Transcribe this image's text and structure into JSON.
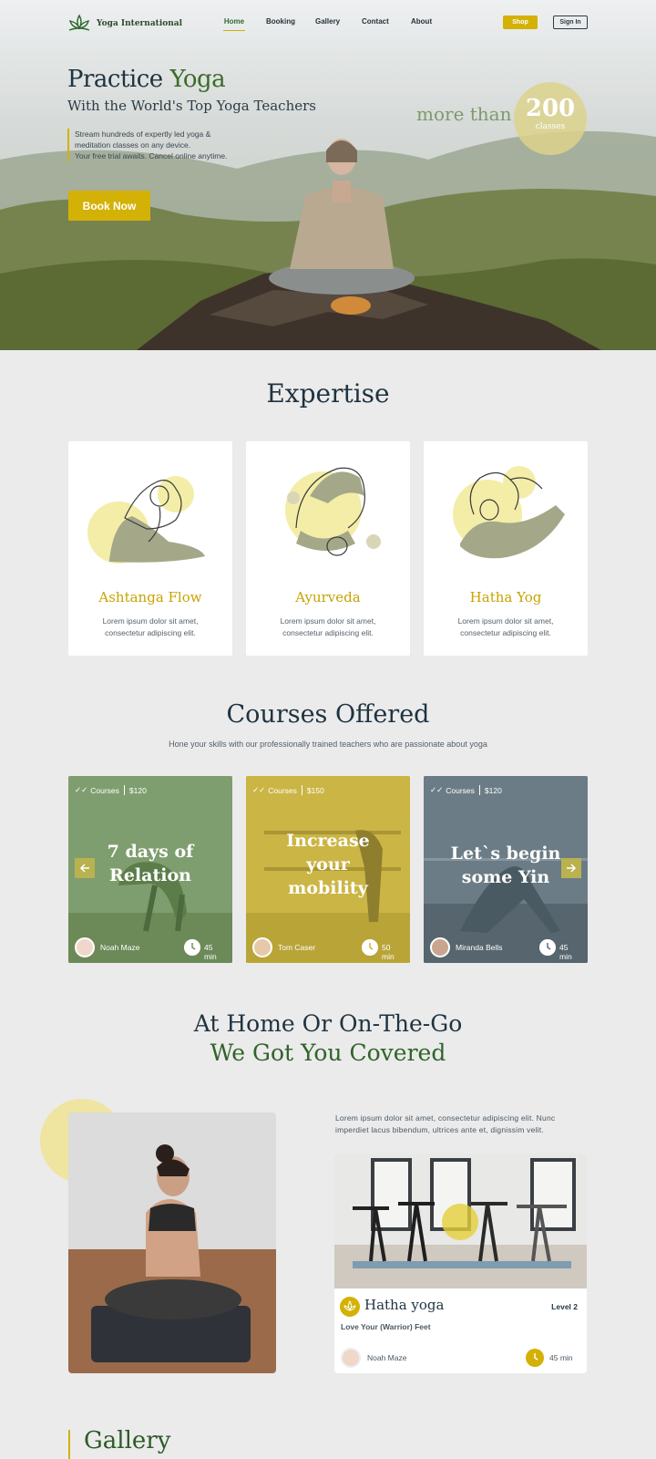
{
  "brand": {
    "name": "Yoga International"
  },
  "nav": {
    "items": [
      "Home",
      "Booking",
      "Gallery",
      "Contact",
      "About"
    ],
    "active": "Home",
    "shop": "Shop",
    "sign_in": "Sign In"
  },
  "hero": {
    "title_part1": "Practice ",
    "title_part2": "Yoga",
    "subtitle": "With the World's Top Yoga Teachers",
    "desc_line1": "Stream hundreds of expertly led yoga &",
    "desc_line2": "meditation classes on any device.",
    "desc_line3": "Your free trial awaits. Cancel online anytime.",
    "cta": "Book Now",
    "more_than": "more than",
    "count": "200",
    "count_label": "classes"
  },
  "expertise": {
    "title": "Expertise",
    "cards": [
      {
        "title": "Ashtanga Flow",
        "text": "Lorem ipsum dolor sit amet, consectetur adipiscing elit."
      },
      {
        "title": "Ayurveda",
        "text": "Lorem ipsum dolor sit amet, consectetur adipiscing elit."
      },
      {
        "title": "Hatha Yog",
        "text": "Lorem ipsum dolor sit amet, consectetur adipiscing elit."
      }
    ]
  },
  "courses": {
    "title": "Courses Offered",
    "subtitle": "Hone your skills with our professionally trained teachers who are passionate about yoga",
    "items": [
      {
        "tag": "Courses",
        "price": "$120",
        "title_line1": "7 days of",
        "title_line2": "Relation",
        "title_line3": "",
        "teacher": "Noah Maze",
        "duration": "45 min",
        "tint": "#6f8f5e"
      },
      {
        "tag": "Courses",
        "price": "$150",
        "title_line1": "Increase",
        "title_line2": "your",
        "title_line3": "mobility",
        "teacher": "Tom Caser",
        "duration": "50 min",
        "tint": "#c9b23c"
      },
      {
        "tag": "Courses",
        "price": "$120",
        "title_line1": "Let`s begin",
        "title_line2": "some Yin",
        "title_line3": "",
        "teacher": "Miranda Bells",
        "duration": "45 min",
        "tint": "#5d6d76"
      }
    ]
  },
  "home": {
    "title_line1": "At Home Or On-The-Go",
    "title_line2": "We Got You Covered",
    "desc": "Lorem ipsum dolor sit amet, consectetur adipiscing elit. Nunc imperdiet lacus bibendum, ultrices ante et, dignissim velit.",
    "class": {
      "name": "Hatha yoga",
      "level": "Level 2",
      "tagline": "Love Your (Warrior) Feet",
      "teacher": "Noah Maze",
      "duration": "45 min"
    }
  },
  "gallery": {
    "title": "Gallery"
  },
  "colors": {
    "accent": "#d4b106",
    "green": "#3b6b2c",
    "navy": "#1f3340"
  }
}
